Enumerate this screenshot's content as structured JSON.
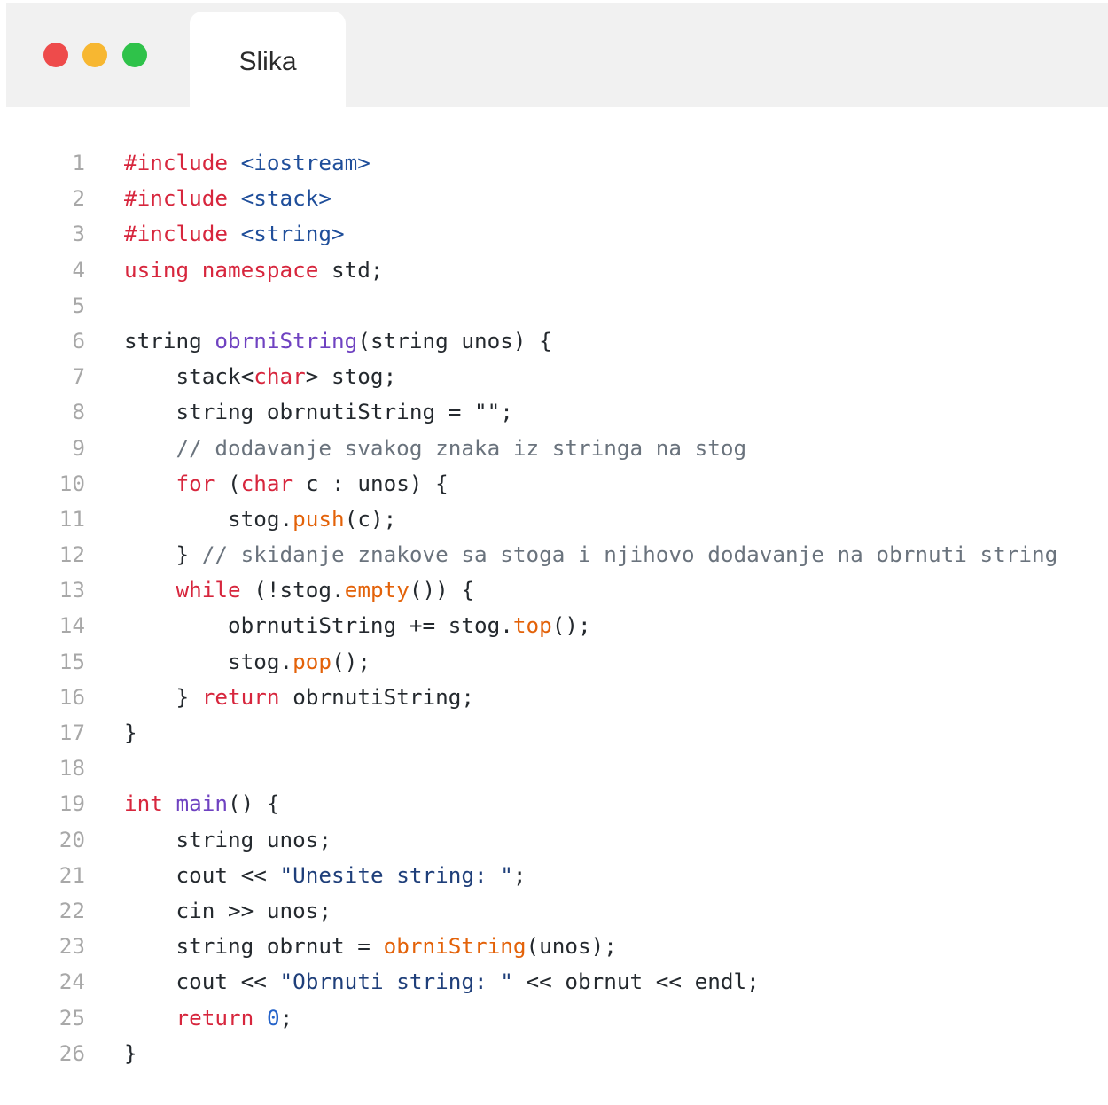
{
  "window": {
    "tab_title": "Slika",
    "buttons": [
      {
        "name": "close",
        "color": "#ee4b4b"
      },
      {
        "name": "minimize",
        "color": "#f7b731"
      },
      {
        "name": "zoom",
        "color": "#2fc24a"
      }
    ]
  },
  "code": {
    "lines": [
      {
        "n": "1",
        "tokens": [
          {
            "t": "#include ",
            "k": "kw"
          },
          {
            "t": "<iostream>",
            "k": "pp"
          }
        ]
      },
      {
        "n": "2",
        "tokens": [
          {
            "t": "#include ",
            "k": "kw"
          },
          {
            "t": "<stack>",
            "k": "pp"
          }
        ]
      },
      {
        "n": "3",
        "tokens": [
          {
            "t": "#include ",
            "k": "kw"
          },
          {
            "t": "<string>",
            "k": "pp"
          }
        ]
      },
      {
        "n": "4",
        "tokens": [
          {
            "t": "using namespace",
            "k": "kw"
          },
          {
            "t": " std;",
            "k": "pl"
          }
        ]
      },
      {
        "n": "5",
        "tokens": []
      },
      {
        "n": "6",
        "tokens": [
          {
            "t": "string ",
            "k": "pl"
          },
          {
            "t": "obrniString",
            "k": "fn"
          },
          {
            "t": "(string unos) {",
            "k": "pl"
          }
        ]
      },
      {
        "n": "7",
        "tokens": [
          {
            "t": "    stack<",
            "k": "pl"
          },
          {
            "t": "char",
            "k": "kw"
          },
          {
            "t": "> stog;",
            "k": "pl"
          }
        ]
      },
      {
        "n": "8",
        "tokens": [
          {
            "t": "    string obrnutiString = \"\";",
            "k": "pl"
          }
        ]
      },
      {
        "n": "9",
        "tokens": [
          {
            "t": "    // dodavanje svakog znaka iz stringa na stog",
            "k": "cm"
          }
        ]
      },
      {
        "n": "10",
        "tokens": [
          {
            "t": "    ",
            "k": "pl"
          },
          {
            "t": "for",
            "k": "kw"
          },
          {
            "t": " (",
            "k": "pl"
          },
          {
            "t": "char",
            "k": "kw"
          },
          {
            "t": " c : unos) {",
            "k": "pl"
          }
        ]
      },
      {
        "n": "11",
        "tokens": [
          {
            "t": "        stog.",
            "k": "pl"
          },
          {
            "t": "push",
            "k": "me"
          },
          {
            "t": "(c);",
            "k": "pl"
          }
        ]
      },
      {
        "n": "12",
        "tokens": [
          {
            "t": "    } ",
            "k": "pl"
          },
          {
            "t": "// skidanje znakove sa stoga i njihovo dodavanje na obrnuti string",
            "k": "cm"
          }
        ]
      },
      {
        "n": "13",
        "tokens": [
          {
            "t": "    ",
            "k": "pl"
          },
          {
            "t": "while",
            "k": "kw"
          },
          {
            "t": " (!stog.",
            "k": "pl"
          },
          {
            "t": "empty",
            "k": "me"
          },
          {
            "t": "()) {",
            "k": "pl"
          }
        ]
      },
      {
        "n": "14",
        "tokens": [
          {
            "t": "        obrnutiString += stog.",
            "k": "pl"
          },
          {
            "t": "top",
            "k": "me"
          },
          {
            "t": "();",
            "k": "pl"
          }
        ]
      },
      {
        "n": "15",
        "tokens": [
          {
            "t": "        stog.",
            "k": "pl"
          },
          {
            "t": "pop",
            "k": "me"
          },
          {
            "t": "();",
            "k": "pl"
          }
        ]
      },
      {
        "n": "16",
        "tokens": [
          {
            "t": "    } ",
            "k": "pl"
          },
          {
            "t": "return",
            "k": "kw"
          },
          {
            "t": " obrnutiString;",
            "k": "pl"
          }
        ]
      },
      {
        "n": "17",
        "tokens": [
          {
            "t": "}",
            "k": "pl"
          }
        ]
      },
      {
        "n": "18",
        "tokens": []
      },
      {
        "n": "19",
        "tokens": [
          {
            "t": "int",
            "k": "kw"
          },
          {
            "t": " ",
            "k": "pl"
          },
          {
            "t": "main",
            "k": "fn"
          },
          {
            "t": "() {",
            "k": "pl"
          }
        ]
      },
      {
        "n": "20",
        "tokens": [
          {
            "t": "    string unos;",
            "k": "pl"
          }
        ]
      },
      {
        "n": "21",
        "tokens": [
          {
            "t": "    cout << ",
            "k": "pl"
          },
          {
            "t": "\"Unesite string: \"",
            "k": "str"
          },
          {
            "t": ";",
            "k": "pl"
          }
        ]
      },
      {
        "n": "22",
        "tokens": [
          {
            "t": "    cin >> unos;",
            "k": "pl"
          }
        ]
      },
      {
        "n": "23",
        "tokens": [
          {
            "t": "    string obrnut = ",
            "k": "pl"
          },
          {
            "t": "obrniString",
            "k": "me"
          },
          {
            "t": "(unos);",
            "k": "pl"
          }
        ]
      },
      {
        "n": "24",
        "tokens": [
          {
            "t": "    cout << ",
            "k": "pl"
          },
          {
            "t": "\"Obrnuti string: \"",
            "k": "str"
          },
          {
            "t": " << obrnut << endl;",
            "k": "pl"
          }
        ]
      },
      {
        "n": "25",
        "tokens": [
          {
            "t": "    ",
            "k": "pl"
          },
          {
            "t": "return",
            "k": "kw"
          },
          {
            "t": " ",
            "k": "pl"
          },
          {
            "t": "0",
            "k": "num"
          },
          {
            "t": ";",
            "k": "pl"
          }
        ]
      },
      {
        "n": "26",
        "tokens": [
          {
            "t": "}",
            "k": "pl"
          }
        ]
      }
    ]
  }
}
